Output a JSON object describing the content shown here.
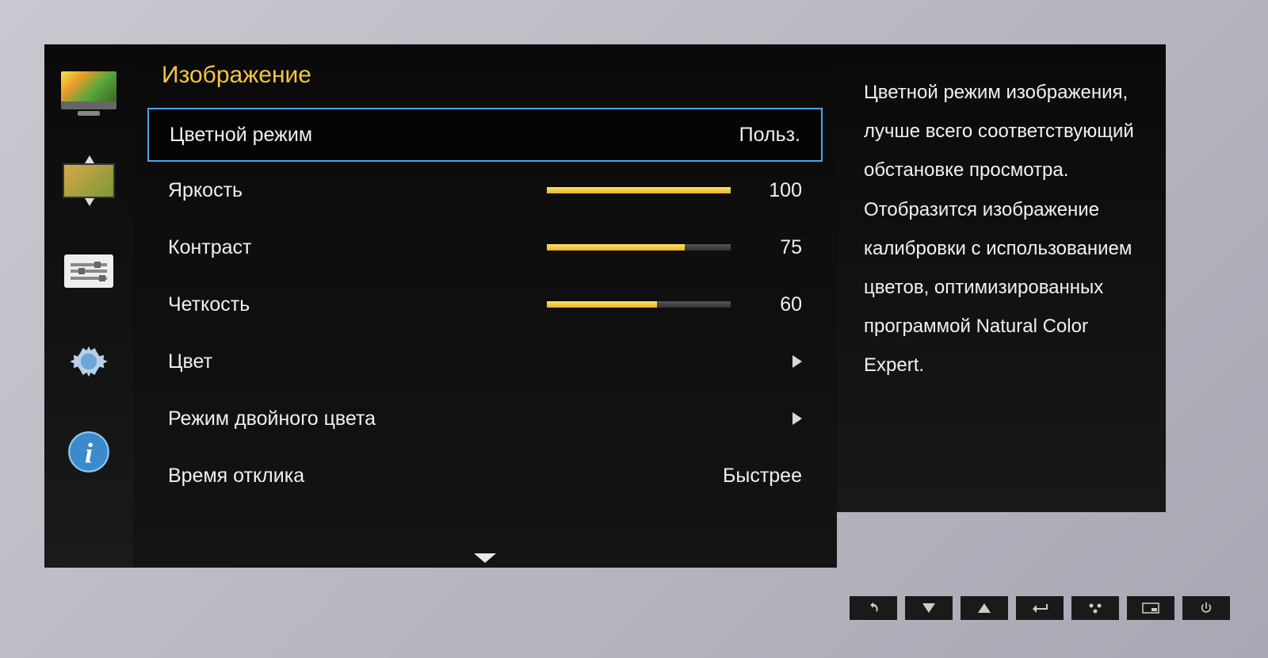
{
  "section_title": "Изображение",
  "settings": {
    "color_mode": {
      "label": "Цветной режим",
      "value": "Польз."
    },
    "brightness": {
      "label": "Яркость",
      "value": 100,
      "max": 100
    },
    "contrast": {
      "label": "Контраст",
      "value": 75,
      "max": 100
    },
    "sharpness": {
      "label": "Четкость",
      "value": 60,
      "max": 100
    },
    "color": {
      "label": "Цвет"
    },
    "dual_color": {
      "label": "Режим двойного цвета"
    },
    "response": {
      "label": "Время отклика",
      "value": "Быстрее"
    }
  },
  "help_text": "Цветной режим изображения, лучше всего соответствующий обстановке просмотра. Отобразится изображение калибровки с использованием цветов, оптимизированных программой Natural Color Expert.",
  "sidebar_icons": [
    "picture",
    "display-adjust",
    "sliders",
    "settings-gear",
    "info"
  ],
  "hw_buttons": [
    "back",
    "down",
    "up",
    "enter",
    "menu",
    "source",
    "power"
  ],
  "colors": {
    "accent": "#f5c542",
    "highlight_border": "#4aa8e8",
    "slider_fill": "#e8b325"
  }
}
